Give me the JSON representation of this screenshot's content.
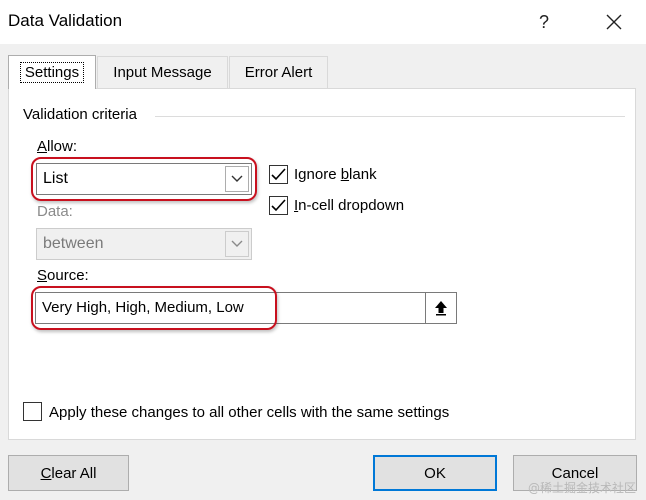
{
  "window": {
    "title": "Data Validation",
    "help_label": "?",
    "close_label": "✕"
  },
  "tabs": [
    {
      "label": "Settings",
      "active": true
    },
    {
      "label": "Input Message",
      "active": false
    },
    {
      "label": "Error Alert",
      "active": false
    }
  ],
  "settings": {
    "group_label": "Validation criteria",
    "allow": {
      "label": "Allow:",
      "value": "List"
    },
    "ignore_blank": {
      "label": "Ignore blank",
      "checked": true
    },
    "in_cell_dropdown": {
      "label": "In-cell dropdown",
      "checked": true
    },
    "data": {
      "label": "Data:",
      "value": "between",
      "disabled": true
    },
    "source": {
      "label": "Source:",
      "value": "Very High, High, Medium, Low"
    },
    "apply_all": {
      "label": "Apply these changes to all other cells with the same settings",
      "checked": false
    }
  },
  "buttons": {
    "clear_all": "Clear All",
    "ok": "OK",
    "cancel": "Cancel"
  },
  "watermark": "@稀土掘金技术社区",
  "colors": {
    "highlight": "#c8101e",
    "ok_border": "#0078d7"
  },
  "icons": {
    "dropdown": "chevron-down-icon",
    "collapse": "up-arrow-icon",
    "check": "checkmark-icon"
  }
}
